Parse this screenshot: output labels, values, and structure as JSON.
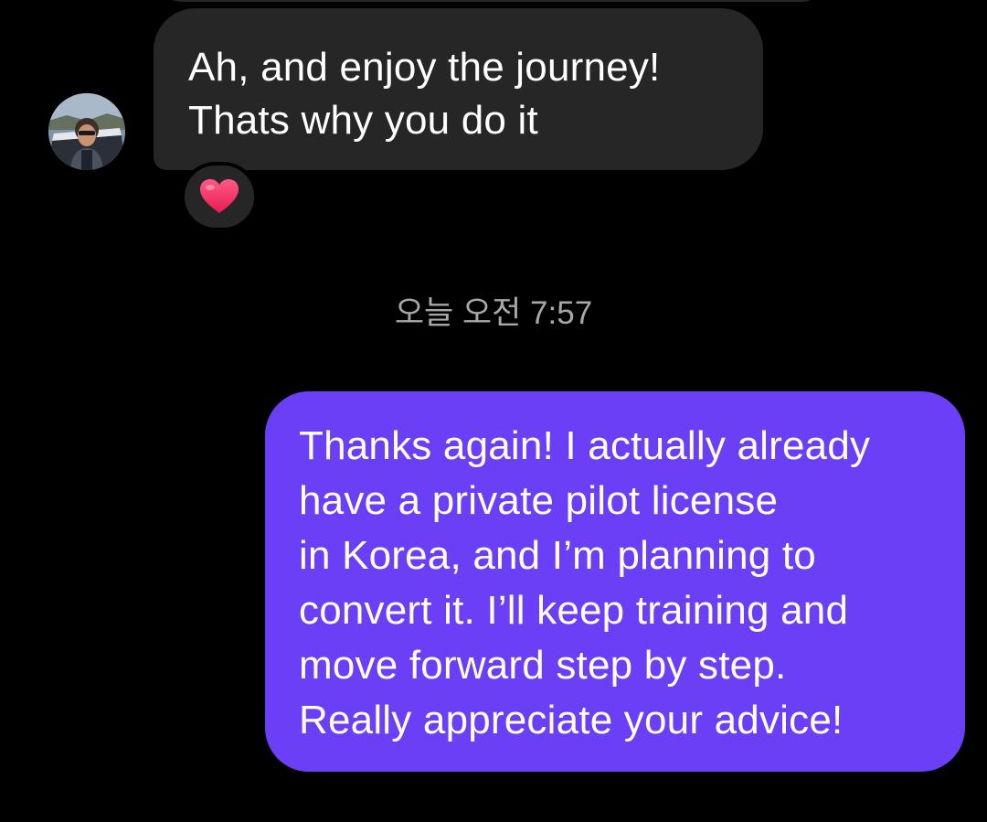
{
  "incoming_message": {
    "lines": [
      "Ah, and enjoy the journey!",
      "Thats why you do it"
    ],
    "reaction": "❤️"
  },
  "timestamp": "오늘 오전 7:57",
  "outgoing_message": {
    "lines": [
      "Thanks again! I actually already",
      "have a private pilot license",
      "in Korea, and I’m planning to",
      "convert it. I’ll keep training and",
      "move forward step by step.",
      "Really appreciate your advice!"
    ]
  },
  "colors": {
    "background": "#000000",
    "incoming_bubble": "#262626",
    "outgoing_bubble": "#6b3ff6",
    "timestamp_text": "#a8a8a8",
    "heart": "#f0245a"
  }
}
